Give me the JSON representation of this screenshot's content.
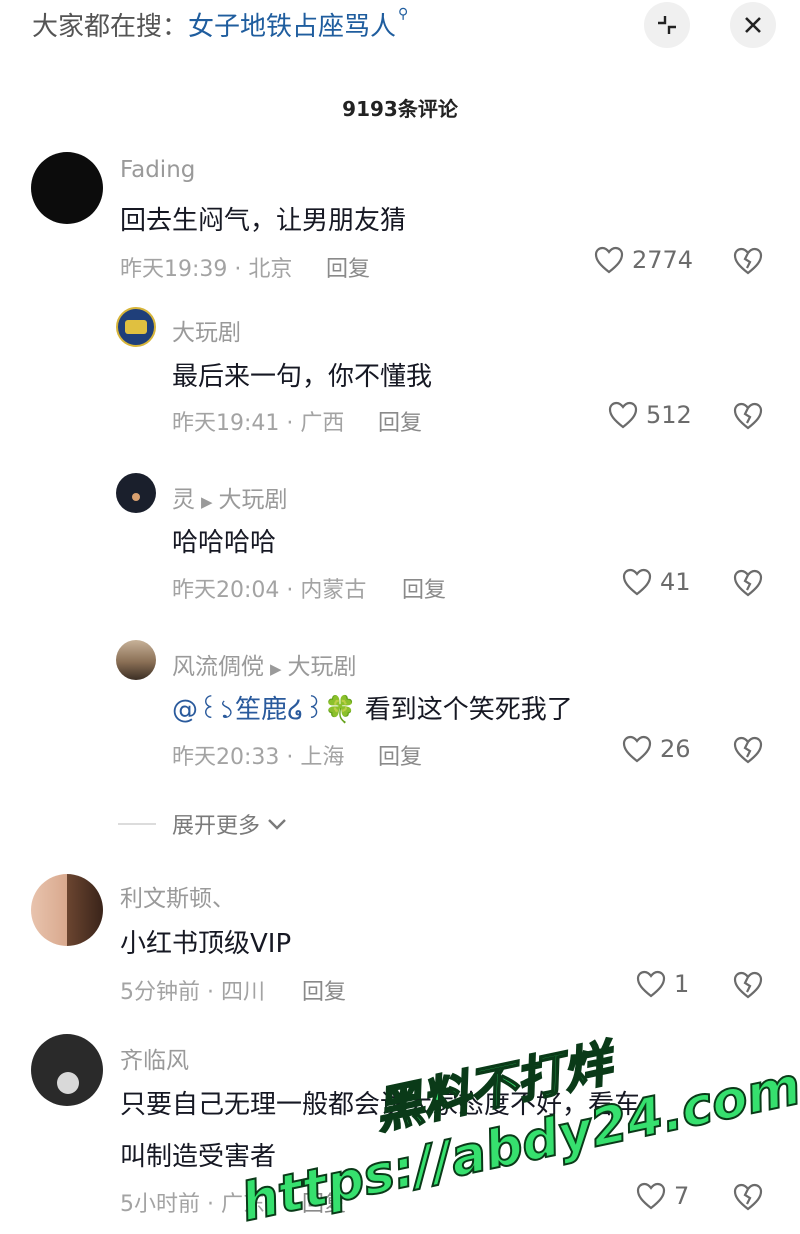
{
  "header": {
    "search_prefix": "大家都在搜：",
    "search_keyword": "女子地铁占座骂人",
    "comment_count": "9193条评论"
  },
  "comments": [
    {
      "name": "Fading",
      "text": "回去生闷气，让男朋友猜",
      "time": "昨天19:39 · 北京",
      "reply": "回复",
      "likes": "2774"
    },
    {
      "name": "大玩剧",
      "text": "最后来一句，你不懂我",
      "time": "昨天19:41 · 广西",
      "reply": "回复",
      "likes": "512"
    },
    {
      "name": "灵",
      "reply_to": "大玩剧",
      "text": "哈哈哈哈",
      "time": "昨天20:04 · 内蒙古",
      "reply": "回复",
      "likes": "41"
    },
    {
      "name": "风流倜傥",
      "reply_to": "大玩剧",
      "mention": "@꒰১笙鹿໒꒱🍀",
      "text": " 看到这个笑死我了",
      "time": "昨天20:33 · 上海",
      "reply": "回复",
      "likes": "26"
    },
    {
      "name": "利文斯顿、",
      "text": "小红书顶级VIP",
      "time": "5分钟前 · 四川",
      "reply": "回复",
      "likes": "1"
    },
    {
      "name": "齐临风",
      "text": "只要自己无理一般都会说大家态度不好，看车",
      "text2": "叫制造受害者",
      "time": "5小时前 · 广东",
      "reply": "回复",
      "likes": "7"
    }
  ],
  "expand_more": "展开更多",
  "watermark": {
    "line1": "黑料不打烊",
    "line2": "https://abdy24.com"
  },
  "colors": {
    "accent": "#1f5d9e",
    "watermark": "#36e06e"
  }
}
